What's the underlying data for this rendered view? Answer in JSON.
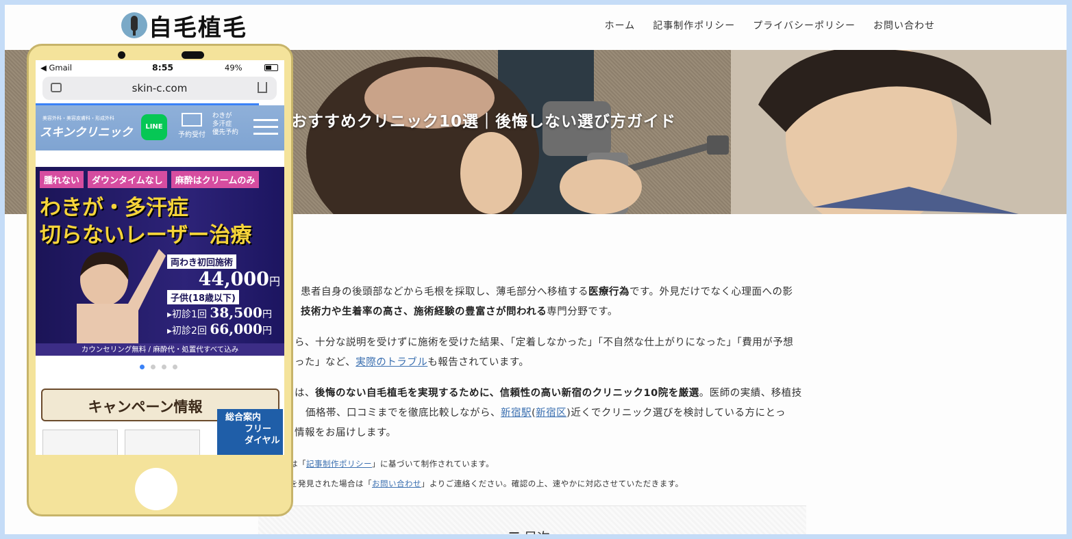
{
  "site": {
    "logo_text": "自毛植毛",
    "nav": [
      "ホーム",
      "記事制作ポリシー",
      "プライバシーポリシー",
      "お問い合わせ"
    ]
  },
  "hero": {
    "title": "おすすめクリニック10選｜後悔しない選び方ガイド"
  },
  "article": {
    "p1": {
      "a": "患者自身の後頭部などから毛根を採取し、薄毛部分へ移植する",
      "b": "医療行為",
      "c": "です。外見だけでなく心理面への影",
      "d": "技術力や生着率の高さ、施術経験の豊富さが問われる",
      "e": "専門分野です。"
    },
    "p2": {
      "a": "ら、十分な説明を受けずに施術を受けた結果、「定着しなかった」「不自然な仕上がりになった」「費用が予想",
      "b": "った」など、",
      "link": "実際のトラブル",
      "c": "も報告されています。"
    },
    "p3": {
      "a": "は、",
      "b": "後悔のない自毛植毛を実現するために、信頼性の高い新宿のクリニック10院を厳選",
      "c": "。医師の実績、移植技",
      "d": "価格帯、口コミまでを徹底比較しながら、",
      "link1": "新宿駅",
      "e": "(",
      "link2": "新宿区",
      "f": ")近くでクリニック選びを検討している方にとっ",
      "g": "情報をお届けします。"
    },
    "note1": {
      "a": "は「",
      "link": "記事制作ポリシー",
      "b": "」に基づいて制作されています。"
    },
    "note2": {
      "a": "を発見された場合は「",
      "link": "お問い合わせ",
      "b": "」よりご連絡ください。確認の上、速やかに対応させていただきます。"
    },
    "toc_title": "目次"
  },
  "phone": {
    "status": {
      "carrier": "◀ Gmail",
      "time": "8:55",
      "battery": "49%"
    },
    "url": "skin-c.com",
    "site_header": {
      "small": "美容外科・美容皮膚科・形成外科",
      "brand": "スキンクリニック",
      "line": "LINE",
      "mail": "予約受付",
      "prio1": "わきが",
      "prio2": "多汗症",
      "prio3": "優先予約"
    },
    "banner": {
      "tags": [
        "腫れない",
        "ダウンタイムなし",
        "麻酔はクリームのみ"
      ],
      "headline1": "わきが・多汗症",
      "headline2": "切らないレーザー治療",
      "label1": "両わき初回施術",
      "price1": "44,000",
      "yen": "円",
      "label2": "子供(18歳以下)",
      "row1_label": "初診1回",
      "row1_price": "38,500",
      "row2_label": "初診2回",
      "row2_price": "66,000",
      "footer": "カウンセリング無料 / 麻酔代・処置代すべて込み"
    },
    "campaign": "キャンペーン情報",
    "freedial": [
      "総合案内",
      "フリー",
      "ダイヤル"
    ]
  }
}
